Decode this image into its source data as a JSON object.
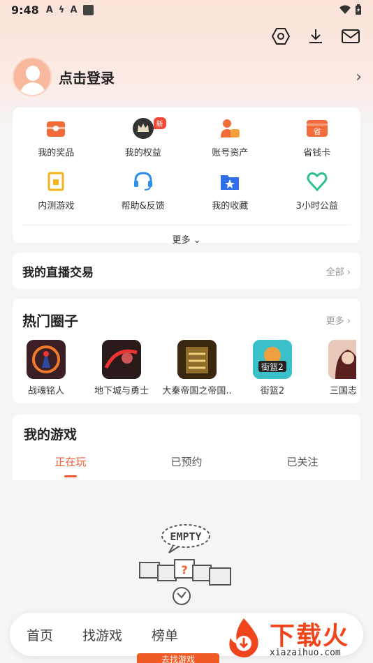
{
  "status_bar": {
    "time": "9:48",
    "indicators": [
      "A",
      "ϟ",
      "A"
    ]
  },
  "top_actions": [
    "settings-hex-icon",
    "download-icon",
    "mail-icon"
  ],
  "profile": {
    "login_label": "点击登录"
  },
  "grid": {
    "items": [
      {
        "label": "我的奖品",
        "icon": "gift-icon",
        "color": "#f26b3a"
      },
      {
        "label": "我的权益",
        "icon": "crown-icon",
        "color": "#333333",
        "badge": "新"
      },
      {
        "label": "账号资产",
        "icon": "account-asset-icon",
        "color": "#f26b3a"
      },
      {
        "label": "省钱卡",
        "icon": "savings-card-icon",
        "color": "#f26b3a"
      },
      {
        "label": "内测游戏",
        "icon": "beta-game-icon",
        "color": "#f5b21a"
      },
      {
        "label": "帮助&反馈",
        "icon": "headset-icon",
        "color": "#2f8ee8"
      },
      {
        "label": "我的收藏",
        "icon": "star-folder-icon",
        "color": "#2f6ee8"
      },
      {
        "label": "3小时公益",
        "icon": "heart-icon",
        "color": "#2fc08e"
      }
    ],
    "more_label": "更多"
  },
  "live_trade": {
    "title": "我的直播交易",
    "link": "全部"
  },
  "hot_circles": {
    "title": "热门圈子",
    "link": "更多",
    "items": [
      {
        "name": "战魂铭人",
        "color": "#3b1f24"
      },
      {
        "name": "地下城与勇士",
        "color": "#5a1c1c"
      },
      {
        "name": "大秦帝国之帝国..",
        "color": "#4a3418"
      },
      {
        "name": "街篮2",
        "color": "#2fb8c0"
      },
      {
        "name": "三国志幻",
        "color": "#7a3a30"
      }
    ]
  },
  "my_games": {
    "title": "我的游戏",
    "tabs": [
      "正在玩",
      "已预约",
      "已关注"
    ],
    "active_tab": 0
  },
  "empty_state": {
    "label": "EMPTY"
  },
  "bottom_nav": {
    "items": [
      "首页",
      "找游戏",
      "榜单"
    ],
    "cta": "去找游戏"
  },
  "watermark": {
    "text": "下载火",
    "url": "xiazaihuo.com"
  },
  "colors": {
    "accent": "#f25a2e",
    "card": "#ffffff",
    "background": "#f5f5f5"
  }
}
